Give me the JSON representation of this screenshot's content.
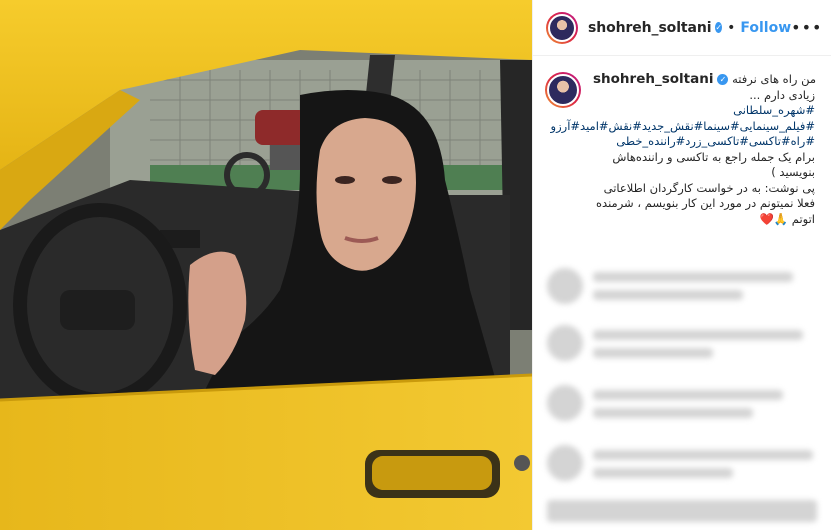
{
  "post": {
    "username": "shohreh_soltani",
    "verified_icon": "verified-badge-icon",
    "follow_label": "Follow",
    "more_label": "•••",
    "caption_lines": [
      "من راه های نرفته",
      "زیادی دارم ...",
      "#شهره_سلطانی",
      "#فیلم_سینمایی#سینما#نقش_جدید#نقش#امید#آرزو",
      "#راه#تاکسی#تاکسی_زرد#راننده_خطی",
      "برام یک جمله راجع به تاکسی و راننده‌هاش",
      "بنویسید )",
      "پی نوشت: به در خواست کارگردان اطلاعاتی",
      "فعلا نمیتونم در مورد این کار بنویسم ، شرمنده",
      "اتوتم 🙏❤️"
    ]
  },
  "colors": {
    "link": "#3897f0",
    "taxi_yellow": "#f2c31a"
  }
}
